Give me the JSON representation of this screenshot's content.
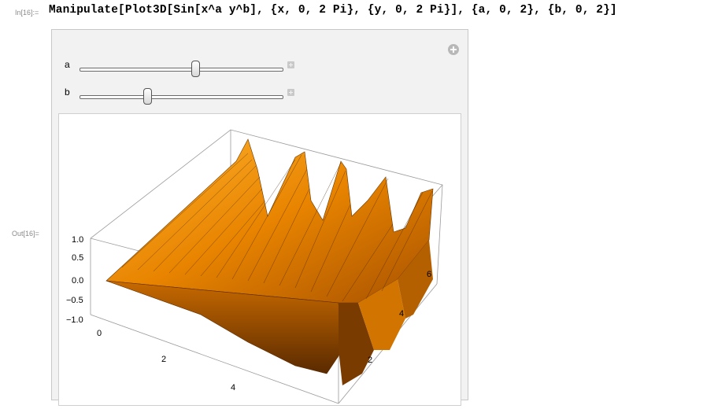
{
  "cell": {
    "in_label": "In[16]:=",
    "out_label": "Out[16]=",
    "input_code": "Manipulate[Plot3D[Sin[x^a y^b], {x, 0, 2 Pi}, {y, 0, 2 Pi}], {a, 0, 2}, {b, 0, 2}]"
  },
  "controls": [
    {
      "name": "a",
      "min": 0,
      "max": 2,
      "value": 1.15
    },
    {
      "name": "b",
      "min": 0,
      "max": 2,
      "value": 0.67
    }
  ],
  "plot": {
    "z_ticks": [
      "1.0",
      "0.5",
      "0.0",
      "−0.5",
      "−1.0"
    ],
    "x_ticks": [
      "0",
      "2",
      "4"
    ],
    "y_ticks": [
      "2",
      "4",
      "6"
    ],
    "surface_color": "#f08c00"
  }
}
